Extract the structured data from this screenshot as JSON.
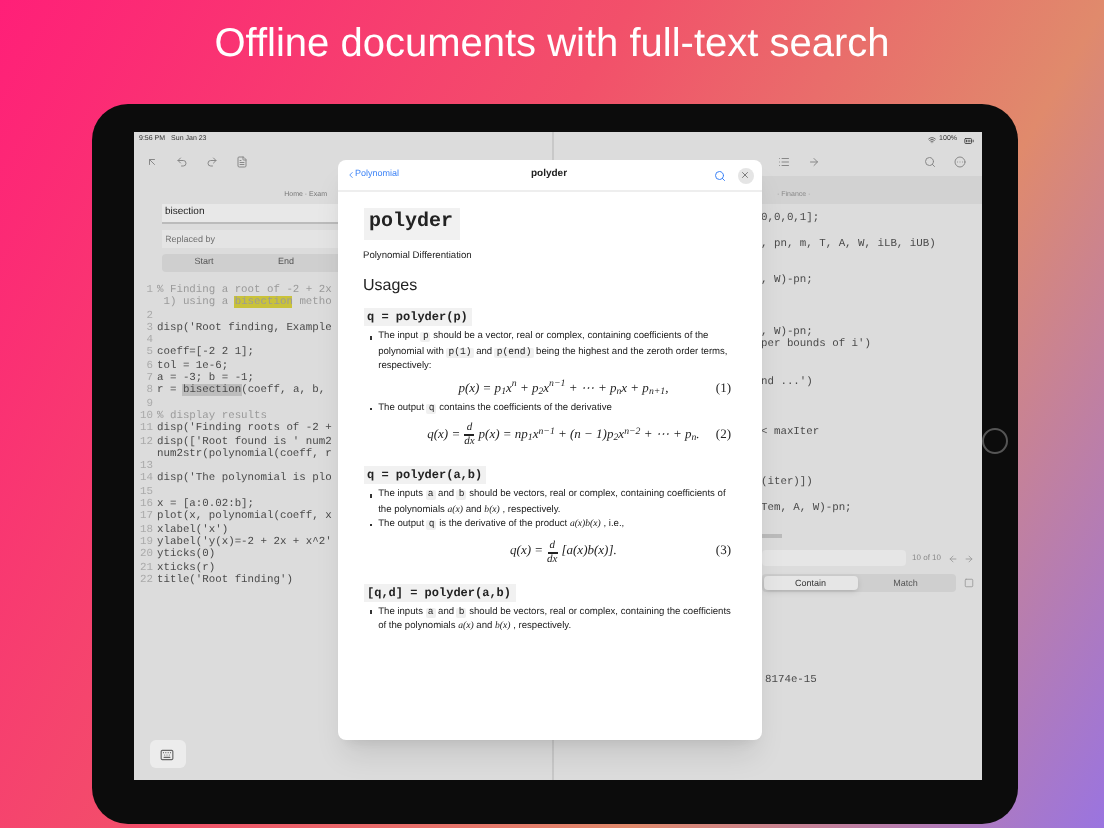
{
  "headline": "Offline documents with full-text search",
  "status_bar": {
    "time": "9:56 PM",
    "date": "Sun Jan 23",
    "battery": "100%"
  },
  "left_pane": {
    "breadcrumb": "Home · Exam",
    "find_field": {
      "value": "bisection"
    },
    "replace_field": {
      "placeholder": "Replaced by"
    },
    "segments": [
      {
        "label": "Start",
        "selected": false
      },
      {
        "label": "End",
        "selected": false
      }
    ],
    "lines": [
      {
        "number": "1",
        "kind": "comment",
        "parts": [
          {
            "text": "% Finding a root of -2 + 2x",
            "kind": "text"
          }
        ]
      },
      {
        "kind": "comment",
        "parts": [
          {
            "text": " 1) using a ",
            "kind": "text"
          },
          {
            "text": "bisection",
            "kind": "match"
          },
          {
            "text": " metho",
            "kind": "text"
          }
        ]
      },
      {
        "number": "2"
      },
      {
        "number": "3",
        "kind": "code",
        "parts": [
          {
            "text": "disp('Root finding, Example",
            "kind": "text"
          }
        ]
      },
      {
        "number": "4"
      },
      {
        "number": "5",
        "kind": "code",
        "parts": [
          {
            "text": "coeff=[-2 2 1];",
            "kind": "text"
          }
        ]
      },
      {
        "number": "6",
        "kind": "code",
        "parts": [
          {
            "text": "tol = 1e-6;",
            "kind": "text"
          }
        ]
      },
      {
        "number": "7",
        "kind": "code",
        "parts": [
          {
            "text": "a = -3; b = -1;",
            "kind": "text"
          }
        ]
      },
      {
        "number": "8",
        "kind": "code",
        "parts": [
          {
            "text": "r = ",
            "kind": "text"
          },
          {
            "text": "bisection",
            "kind": "current_match"
          },
          {
            "text": "(coeff, a, b,",
            "kind": "text"
          }
        ]
      },
      {
        "number": "9"
      },
      {
        "number": "10",
        "kind": "comment",
        "parts": [
          {
            "text": "% display results",
            "kind": "text"
          }
        ]
      },
      {
        "number": "11",
        "kind": "code",
        "parts": [
          {
            "text": "disp('Finding roots of -2 +",
            "kind": "text"
          }
        ]
      },
      {
        "number": "12",
        "kind": "code",
        "parts": [
          {
            "text": "disp(['Root found is ' num2",
            "kind": "text"
          }
        ]
      },
      {
        "kind": "code",
        "parts": [
          {
            "text": "num2str(polynomial(coeff, r",
            "kind": "text"
          }
        ]
      },
      {
        "number": "13"
      },
      {
        "number": "14",
        "kind": "code",
        "parts": [
          {
            "text": "disp('The polynomial is plo",
            "kind": "text"
          }
        ]
      },
      {
        "number": "15"
      },
      {
        "number": "16",
        "kind": "code",
        "parts": [
          {
            "text": "x = [a:0.02:b];",
            "kind": "text"
          }
        ]
      },
      {
        "number": "17",
        "kind": "code",
        "parts": [
          {
            "text": "plot(x, polynomial(coeff, x",
            "kind": "text"
          }
        ]
      },
      {
        "number": "18",
        "kind": "code",
        "parts": [
          {
            "text": "xlabel('x')",
            "kind": "text"
          }
        ]
      },
      {
        "number": "19",
        "kind": "code",
        "parts": [
          {
            "text": "ylabel('y(x)=-2 + 2x + x^2'",
            "kind": "text"
          }
        ]
      },
      {
        "number": "20",
        "kind": "code",
        "parts": [
          {
            "text": "yticks(0)",
            "kind": "text"
          }
        ]
      },
      {
        "number": "21",
        "kind": "code",
        "parts": [
          {
            "text": "xticks(r)",
            "kind": "text"
          }
        ]
      },
      {
        "number": "22",
        "kind": "code",
        "parts": [
          {
            "text": "title('Root finding')",
            "kind": "text"
          }
        ]
      }
    ]
  },
  "right_pane": {
    "breadcrumb": "· Finance ·",
    "lines": [
      {
        "text": "0,0,0,1];"
      },
      {
        "text": ", pn, m, T, A, W, iLB, iUB)"
      },
      {
        "text": ", W)-pn;"
      },
      {
        "text": ", W)-pn;"
      },
      {
        "text": "per bounds of i')"
      },
      {
        "text": "nd ...')"
      },
      {
        "text": "< maxIter"
      },
      {
        "text": "(iter)])"
      },
      {
        "text": "Tem, A, W)-pn;"
      }
    ],
    "search_count": "10 of 10",
    "segments": [
      {
        "label": "Contain",
        "selected": true
      },
      {
        "label": "Match",
        "selected": false
      }
    ],
    "output": "8174e-15"
  },
  "doc_popover": {
    "back_label": "Polynomial",
    "title": "polyder",
    "heading": "polyder",
    "subtitle": "Polynomial Differentiation",
    "section_title": "Usages",
    "usages": [
      {
        "signature": "q = polyder(p)",
        "items": [
          {
            "kind": "bullet",
            "parts": [
              {
                "text": "The input ",
                "kind": "text"
              },
              {
                "text": "p",
                "kind": "code"
              },
              {
                "text": " should be a vector, real or complex, containing coefficients of the polynomial with ",
                "kind": "text"
              },
              {
                "text": "p(1)",
                "kind": "code"
              },
              {
                "text": " and ",
                "kind": "text"
              },
              {
                "text": "p(end)",
                "kind": "code"
              },
              {
                "text": " being the highest and the zeroth order terms, respectively:",
                "kind": "text"
              }
            ]
          },
          {
            "kind": "equation",
            "number": "(1)",
            "parts": [
              {
                "kind": "text",
                "text": "p(x) = p$_{1}$x$^{n}$ + p$_{2}$x$^{n−1}$ + ⋯ + p$_{n}$x + p$_{n+1}$,"
              }
            ]
          },
          {
            "kind": "bullet",
            "parts": [
              {
                "text": "The output ",
                "kind": "text"
              },
              {
                "text": "q",
                "kind": "code"
              },
              {
                "text": " contains the coefficients of the derivative",
                "kind": "text"
              }
            ]
          },
          {
            "kind": "equation",
            "number": "(2)",
            "parts": [
              {
                "kind": "text",
                "text": "q(x) ="
              },
              {
                "kind": "fraction",
                "numerator": "d",
                "denominator": "dx"
              },
              {
                "kind": "text",
                "text": "p(x) = np$_{1}$x$^{n−1}$ + (n − 1)p$_{2}$x$^{n−2}$ + ⋯ + p$_{n}$."
              }
            ]
          }
        ]
      },
      {
        "signature": "q = polyder(a,b)",
        "items": [
          {
            "kind": "bullet",
            "parts": [
              {
                "text": "The inputs ",
                "kind": "text"
              },
              {
                "text": "a",
                "kind": "code"
              },
              {
                "text": " and ",
                "kind": "text"
              },
              {
                "text": "b",
                "kind": "code"
              },
              {
                "text": " should be vectors, real or complex, containing coefficients of the polynomials ",
                "kind": "text"
              },
              {
                "text": "a(x)",
                "kind": "math"
              },
              {
                "text": " and ",
                "kind": "text"
              },
              {
                "text": "b(x)",
                "kind": "math"
              },
              {
                "text": " , respectively.",
                "kind": "text"
              }
            ]
          },
          {
            "kind": "bullet",
            "parts": [
              {
                "text": "The output ",
                "kind": "text"
              },
              {
                "text": "q",
                "kind": "code"
              },
              {
                "text": " is the derivative of the product ",
                "kind": "text"
              },
              {
                "text": "a(x)b(x)",
                "kind": "math"
              },
              {
                "text": " , i.e.,",
                "kind": "text"
              }
            ]
          },
          {
            "kind": "equation",
            "number": "(3)",
            "parts": [
              {
                "kind": "text",
                "text": "q(x) ="
              },
              {
                "kind": "fraction",
                "numerator": "d",
                "denominator": "dx"
              },
              {
                "kind": "text",
                "text": "[a(x)b(x)]."
              }
            ]
          }
        ]
      },
      {
        "signature": "[q,d] = polyder(a,b)",
        "items": [
          {
            "kind": "bullet",
            "parts": [
              {
                "text": "The inputs ",
                "kind": "text"
              },
              {
                "text": "a",
                "kind": "code"
              },
              {
                "text": " and ",
                "kind": "text"
              },
              {
                "text": "b",
                "kind": "code"
              },
              {
                "text": " should be vectors, real or complex, containing the coefficients of the polynomials ",
                "kind": "text"
              },
              {
                "text": "a(x)",
                "kind": "math"
              },
              {
                "text": " and ",
                "kind": "text"
              },
              {
                "text": "b(x)",
                "kind": "math"
              },
              {
                "text": " , respectively.",
                "kind": "text"
              }
            ]
          }
        ]
      }
    ]
  }
}
